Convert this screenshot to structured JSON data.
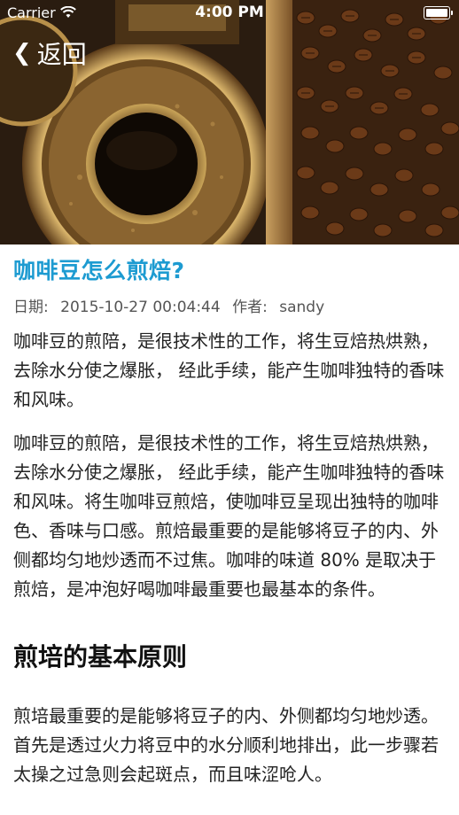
{
  "status_bar": {
    "carrier": "Carrier",
    "time": "4:00 PM"
  },
  "nav": {
    "back_label": "返回"
  },
  "hero": {
    "icon": "coffee-roasting-photo"
  },
  "article": {
    "title": "咖啡豆怎么煎焙?",
    "date_label": "日期:",
    "date_value": "2015-10-27 00:04:44",
    "author_label": "作者:",
    "author_value": "sandy",
    "paragraph_1": "咖啡豆的煎陪，是很技术性的工作，将生豆焙热烘熟，去除水分使之爆胀， 经此手续，能产生咖啡独特的香味和风味。",
    "paragraph_2": "咖啡豆的煎陪，是很技术性的工作，将生豆焙热烘熟，去除水分使之爆胀， 经此手续，能产生咖啡独特的香味和风味。将生咖啡豆煎焙，使咖啡豆呈现出独特的咖啡色、香味与口感。煎焙最重要的是能够将豆子的内、外侧都均匀地炒透而不过焦。咖啡的味道 80% 是取决于煎焙，是冲泡好喝咖啡最重要也最基本的条件。",
    "section_title": "煎培的基本原则",
    "paragraph_3": "煎培最重要的是能够将豆子的内、外侧都均匀地炒透。首先是透过火力将豆中的水分顺利地排出，此一步骤若太操之过急则会起斑点，而且味涩呛人。"
  }
}
